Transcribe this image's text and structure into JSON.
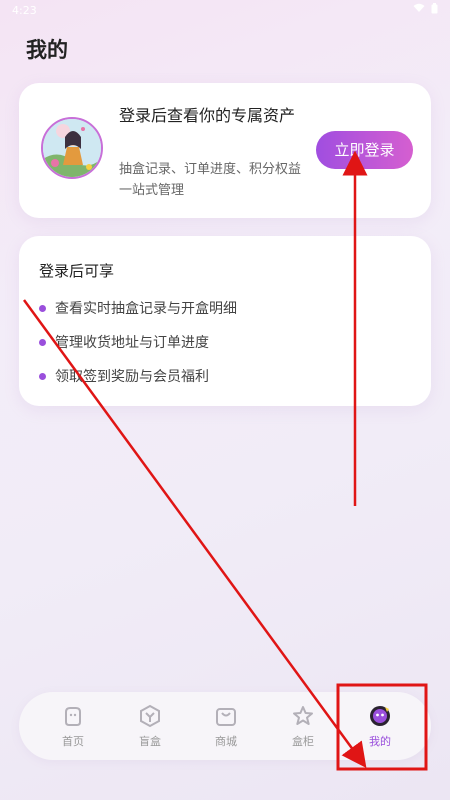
{
  "status_bar": {
    "time": "4:23"
  },
  "page": {
    "title": "我的"
  },
  "login_card": {
    "headline": "登录后查看你的专属资产",
    "description": "抽盒记录、订单进度、积分权益一站式管理",
    "login_button": "立即登录"
  },
  "benefits": {
    "title": "登录后可享",
    "items": [
      "查看实时抽盒记录与开盒明细",
      "管理收货地址与订单进度",
      "领取签到奖励与会员福利"
    ]
  },
  "nav": {
    "items": [
      {
        "label": "首页",
        "icon": "home-icon"
      },
      {
        "label": "盲盒",
        "icon": "blind-box-icon"
      },
      {
        "label": "商城",
        "icon": "mall-icon"
      },
      {
        "label": "盒柜",
        "icon": "box-cabinet-icon"
      },
      {
        "label": "我的",
        "icon": "profile-icon",
        "active": true
      }
    ]
  },
  "colors": {
    "accent": "#9a4fdc",
    "annotation": "#e01515"
  }
}
